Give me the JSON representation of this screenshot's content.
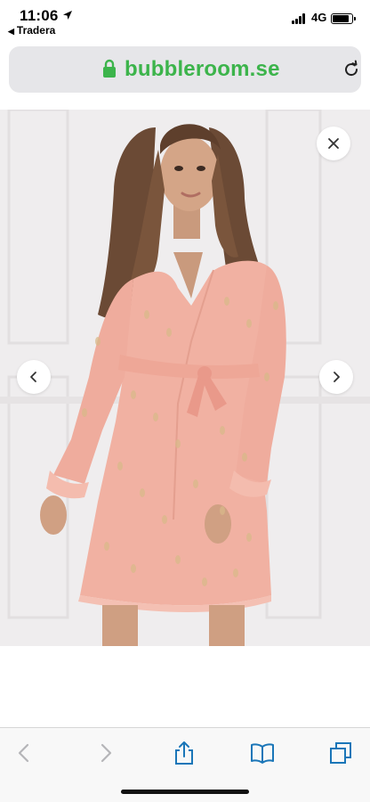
{
  "status_bar": {
    "time": "11:06",
    "back_app": "Tradera",
    "network": "4G"
  },
  "browser": {
    "domain": "bubbleroom.se",
    "secure": true,
    "accent_color": "#3cb44b",
    "icon_color": "#1a76b8"
  },
  "gallery": {
    "close_icon": "close-icon",
    "prev_icon": "chevron-left-icon",
    "next_icon": "chevron-right-icon"
  },
  "toolbar": {
    "icons": [
      "back-arrow-icon",
      "forward-arrow-icon",
      "share-icon",
      "bookmarks-icon",
      "tabs-icon"
    ]
  }
}
